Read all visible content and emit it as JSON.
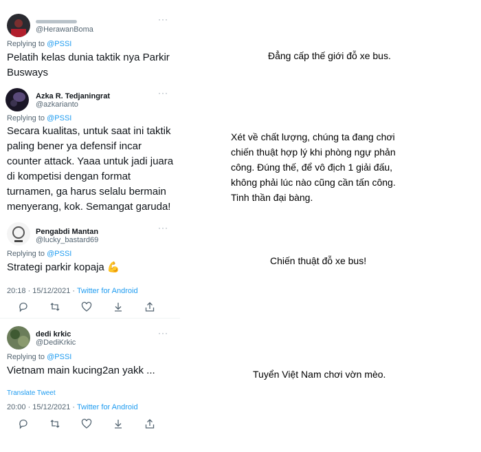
{
  "tweets": [
    {
      "name": "",
      "handle": "@HerawanBoma",
      "reply_prefix": "Replying to",
      "reply_to": "@PSSI",
      "text": "Pelatih kelas dunia taktik nya Parkir Busways"
    },
    {
      "name": "Azka R. Tedjaningrat",
      "handle": "@azkarianto",
      "reply_prefix": "Replying to",
      "reply_to": "@PSSI",
      "text": "Secara kualitas, untuk saat ini taktik paling bener ya defensif incar counter attack. Yaaa untuk jadi juara di kompetisi dengan format turnamen, ga harus selalu bermain menyerang, kok. Semangat garuda!"
    },
    {
      "name": "Pengabdi Mantan",
      "handle": "@lucky_bastard69",
      "reply_prefix": "Replying to",
      "reply_to": "@PSSI",
      "text": "Strategi parkir kopaja",
      "emoji": "💪",
      "time": "20:18 · 15/12/2021 · ",
      "source": "Twitter for Android"
    },
    {
      "name": "dedi krkic",
      "handle": "@DediKrkic",
      "reply_prefix": "Replying to",
      "reply_to": "@PSSI",
      "text": "Vietnam main kucing2an yakk ...",
      "translate": "Translate Tweet",
      "time": "20:00 · 15/12/2021 · ",
      "source": "Twitter for Android"
    }
  ],
  "more_glyph": "···",
  "action_icons": [
    "reply-icon",
    "retweet-icon",
    "like-icon",
    "download-icon",
    "share-icon"
  ],
  "captions": {
    "c1": "Đẳng cấp thế giới đỗ xe bus.",
    "c2": "Xét về chất lượng, chúng ta đang chơi chiến thuật hợp lý khi phòng ngự phản công. Đúng thế, để vô địch 1 giải đấu, không phải lúc nào cũng cần tấn công. Tinh thần đại bàng.",
    "c3": "Chiến thuật đỗ xe bus!",
    "c4": "Tuyển Việt Nam chơi vờn mèo."
  },
  "colors": {
    "link": "#1d9bf0",
    "muted": "#536471",
    "text": "#0f1419"
  }
}
